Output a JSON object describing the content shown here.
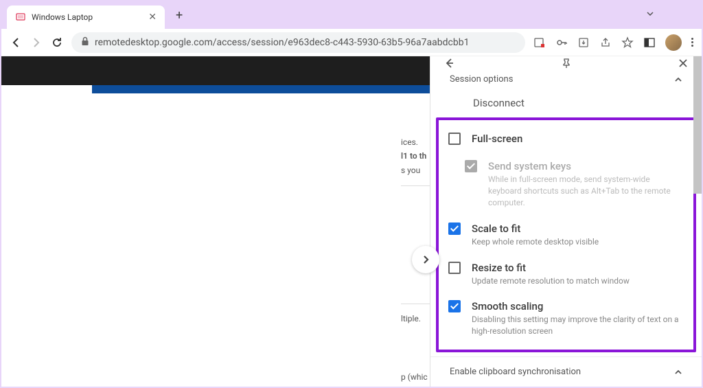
{
  "tab": {
    "title": "Windows Laptop"
  },
  "url": "remotedesktop.google.com/access/session/e963dec8-c443-5930-63b5-96a7aabdcbb1",
  "bg_fragments": {
    "l1": "ices.",
    "l2": "l1 to th",
    "l3": "s you",
    "l4": "ltiple.",
    "l5": "p (whic"
  },
  "panel": {
    "section": "Session options",
    "disconnect": "Disconnect",
    "options": {
      "fullscreen": {
        "title": "Full-screen"
      },
      "syskeys": {
        "title": "Send system keys",
        "desc": "While in full-screen mode, send system-wide keyboard shortcuts such as Alt+Tab to the remote computer."
      },
      "scale": {
        "title": "Scale to fit",
        "desc": "Keep whole remote desktop visible"
      },
      "resize": {
        "title": "Resize to fit",
        "desc": "Update remote resolution to match window"
      },
      "smooth": {
        "title": "Smooth scaling",
        "desc": "Disabling this setting may improve the clarity of text on a high-resolution screen"
      }
    },
    "clipboard": "Enable clipboard synchronisation"
  }
}
